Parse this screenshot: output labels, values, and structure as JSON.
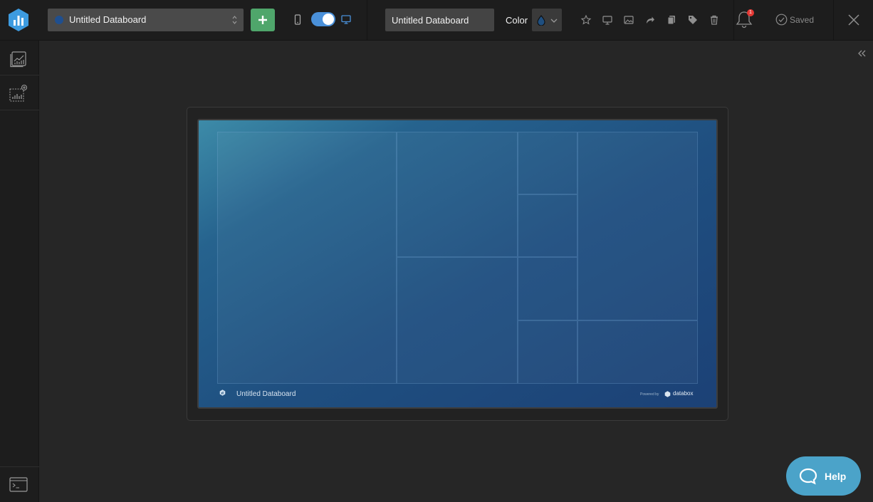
{
  "toolbar": {
    "board_name": "Untitled Databoard",
    "title_value": "Untitled Databoard",
    "color_label": "Color",
    "notification_count": "1",
    "status": "Saved",
    "tools": [
      "star-icon",
      "monitor-icon",
      "image-icon",
      "share-icon",
      "copy-icon",
      "tag-icon",
      "trash-icon"
    ]
  },
  "preview": {
    "board_title": "Untitled Databoard",
    "powered_by": "Powered by",
    "brand": "databox"
  },
  "help": {
    "label": "Help"
  },
  "colors": {
    "accent": "#4a90d9",
    "add": "#4fa66b",
    "help": "#4ba3c9",
    "badge": "#e53935"
  }
}
